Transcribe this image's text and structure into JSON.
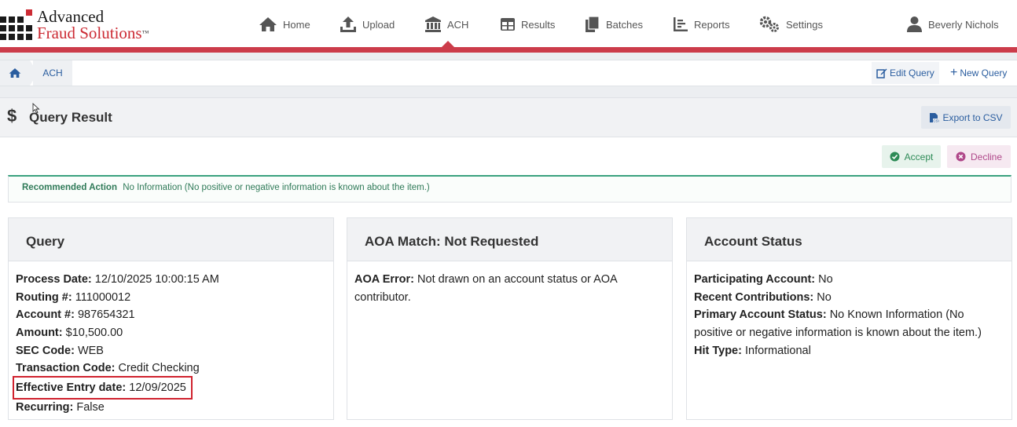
{
  "logo": {
    "line1": "Advanced",
    "line2": "Fraud Solutions",
    "tm": "™"
  },
  "nav": [
    {
      "label": "Home",
      "icon": "home-icon"
    },
    {
      "label": "Upload",
      "icon": "upload-icon"
    },
    {
      "label": "ACH",
      "icon": "bank-icon"
    },
    {
      "label": "Results",
      "icon": "table-icon"
    },
    {
      "label": "Batches",
      "icon": "files-icon"
    },
    {
      "label": "Reports",
      "icon": "report-icon"
    },
    {
      "label": "Settings",
      "icon": "gears-icon"
    }
  ],
  "user": {
    "name": "Beverly Nichols"
  },
  "breadcrumb": {
    "current": "ACH"
  },
  "actions": {
    "edit_query": "Edit Query",
    "new_query": "New Query"
  },
  "panel": {
    "symbol": "$",
    "title": "Query Result",
    "export": "Export to CSV",
    "accept": "Accept",
    "decline": "Decline"
  },
  "recommended": {
    "label": "Recommended Action",
    "text": "No Information (No positive or negative information is known about the item.)"
  },
  "query": {
    "title": "Query",
    "fields": [
      {
        "label": "Process Date:",
        "value": "12/10/2025 10:00:15 AM"
      },
      {
        "label": "Routing #:",
        "value": "111000012"
      },
      {
        "label": "Account #:",
        "value": "987654321"
      },
      {
        "label": "Amount:",
        "value": "$10,500.00"
      },
      {
        "label": "SEC Code:",
        "value": "WEB"
      },
      {
        "label": "Transaction Code:",
        "value": "Credit Checking"
      },
      {
        "label": "Effective Entry date:",
        "value": "12/09/2025"
      },
      {
        "label": "Recurring:",
        "value": "False"
      }
    ]
  },
  "aoa": {
    "title": "AOA Match: Not Requested",
    "error_label": "AOA Error:",
    "error_value": "Not drawn on an account status or AOA contributor."
  },
  "account_status": {
    "title": "Account Status",
    "fields": [
      {
        "label": "Participating Account:",
        "value": "No"
      },
      {
        "label": "Recent Contributions:",
        "value": "No"
      },
      {
        "label": "Primary Account Status:",
        "value": "No Known Information (No positive or negative information is known about the item.)"
      },
      {
        "label": "Hit Type:",
        "value": "Informational"
      }
    ]
  },
  "colors": {
    "brand_red": "#cc3c4a",
    "link_blue": "#2a5d9f",
    "accept_green": "#2e8b57",
    "decline_magenta": "#b0488a",
    "highlight_red": "#d0222e"
  }
}
